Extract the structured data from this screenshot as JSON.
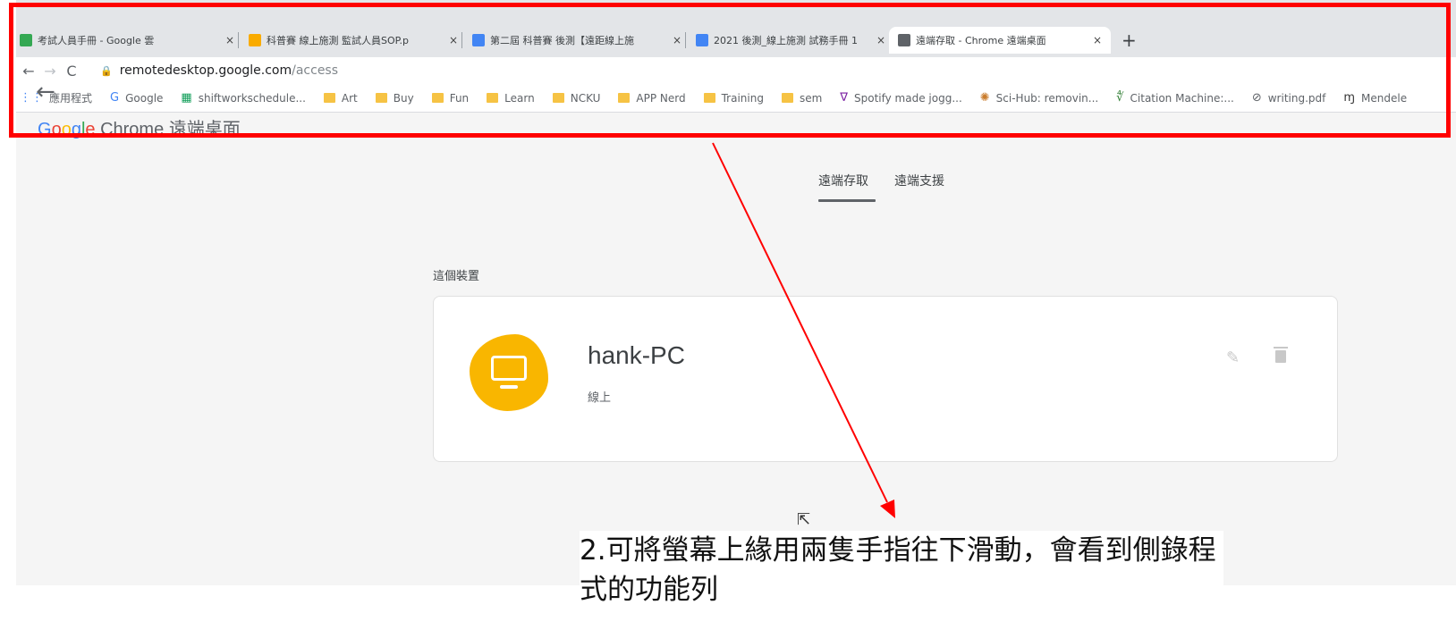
{
  "browser": {
    "tabs": [
      {
        "title": "考試人員手冊 - Google 雲",
        "color": "#34a853"
      },
      {
        "title": "科普賽 線上施測 監試人員SOP.p",
        "color": "#f9ab00"
      },
      {
        "title": "第二屆 科普賽 後測【遠距線上施",
        "color": "#4285f4"
      },
      {
        "title": "2021 後測_線上施測 試務手冊 1",
        "color": "#4285f4"
      },
      {
        "title": "遠端存取 - Chrome 遠端桌面",
        "color": "#5f6368"
      }
    ],
    "close_glyph": "×",
    "new_tab_glyph": "+",
    "url_host": "remotedesktop.google.com",
    "url_path": "/access",
    "lock_glyph": "🔒",
    "bookmarks": [
      {
        "label": "應用程式",
        "icon": "apps-grid-icon",
        "glyph": "⋮⋮",
        "color": "#4285f4"
      },
      {
        "label": "Google",
        "icon": "google-g-icon",
        "glyph": "G",
        "color": "#4285f4"
      },
      {
        "label": "shiftworkschedule...",
        "icon": "calendar-icon",
        "glyph": "▦",
        "color": "#0f9d58"
      },
      {
        "label": "Art",
        "icon": "folder-icon"
      },
      {
        "label": "Buy",
        "icon": "folder-icon"
      },
      {
        "label": "Fun",
        "icon": "folder-icon"
      },
      {
        "label": "Learn",
        "icon": "folder-icon"
      },
      {
        "label": "NCKU",
        "icon": "folder-icon"
      },
      {
        "label": "APP Nerd",
        "icon": "folder-icon"
      },
      {
        "label": "Training",
        "icon": "folder-icon"
      },
      {
        "label": "sem",
        "icon": "folder-icon"
      },
      {
        "label": "Spotify made jogg...",
        "icon": "vee-icon",
        "glyph": "∇",
        "color": "#7b1fa2"
      },
      {
        "label": "Sci-Hub: removin...",
        "icon": "raven-icon",
        "glyph": "✺",
        "color": "#c97b2b"
      },
      {
        "label": "Citation Machine:...",
        "icon": "citation-icon",
        "glyph": "∜",
        "color": "#2e7d32"
      },
      {
        "label": "writing.pdf",
        "icon": "globe-icon",
        "glyph": "⊘",
        "color": "#5f6368"
      },
      {
        "label": "Mendele",
        "icon": "mendeley-icon",
        "glyph": "ɱ",
        "color": "#333333"
      }
    ],
    "back_arrow": "←"
  },
  "page": {
    "product_letters": [
      "G",
      "o",
      "o",
      "g",
      "l",
      "e"
    ],
    "product_suffix": " Chrome 遠端桌面",
    "tabs": [
      "遠端存取",
      "遠端支援"
    ],
    "section_title": "這個裝置",
    "device": {
      "name": "hank-PC",
      "status": "線上"
    },
    "edit_glyph": "✎"
  },
  "annotation": {
    "text": "2.可將螢幕上緣用兩隻手指往下滑動，會看到側錄程式的功能列",
    "color": "#ff0000"
  }
}
